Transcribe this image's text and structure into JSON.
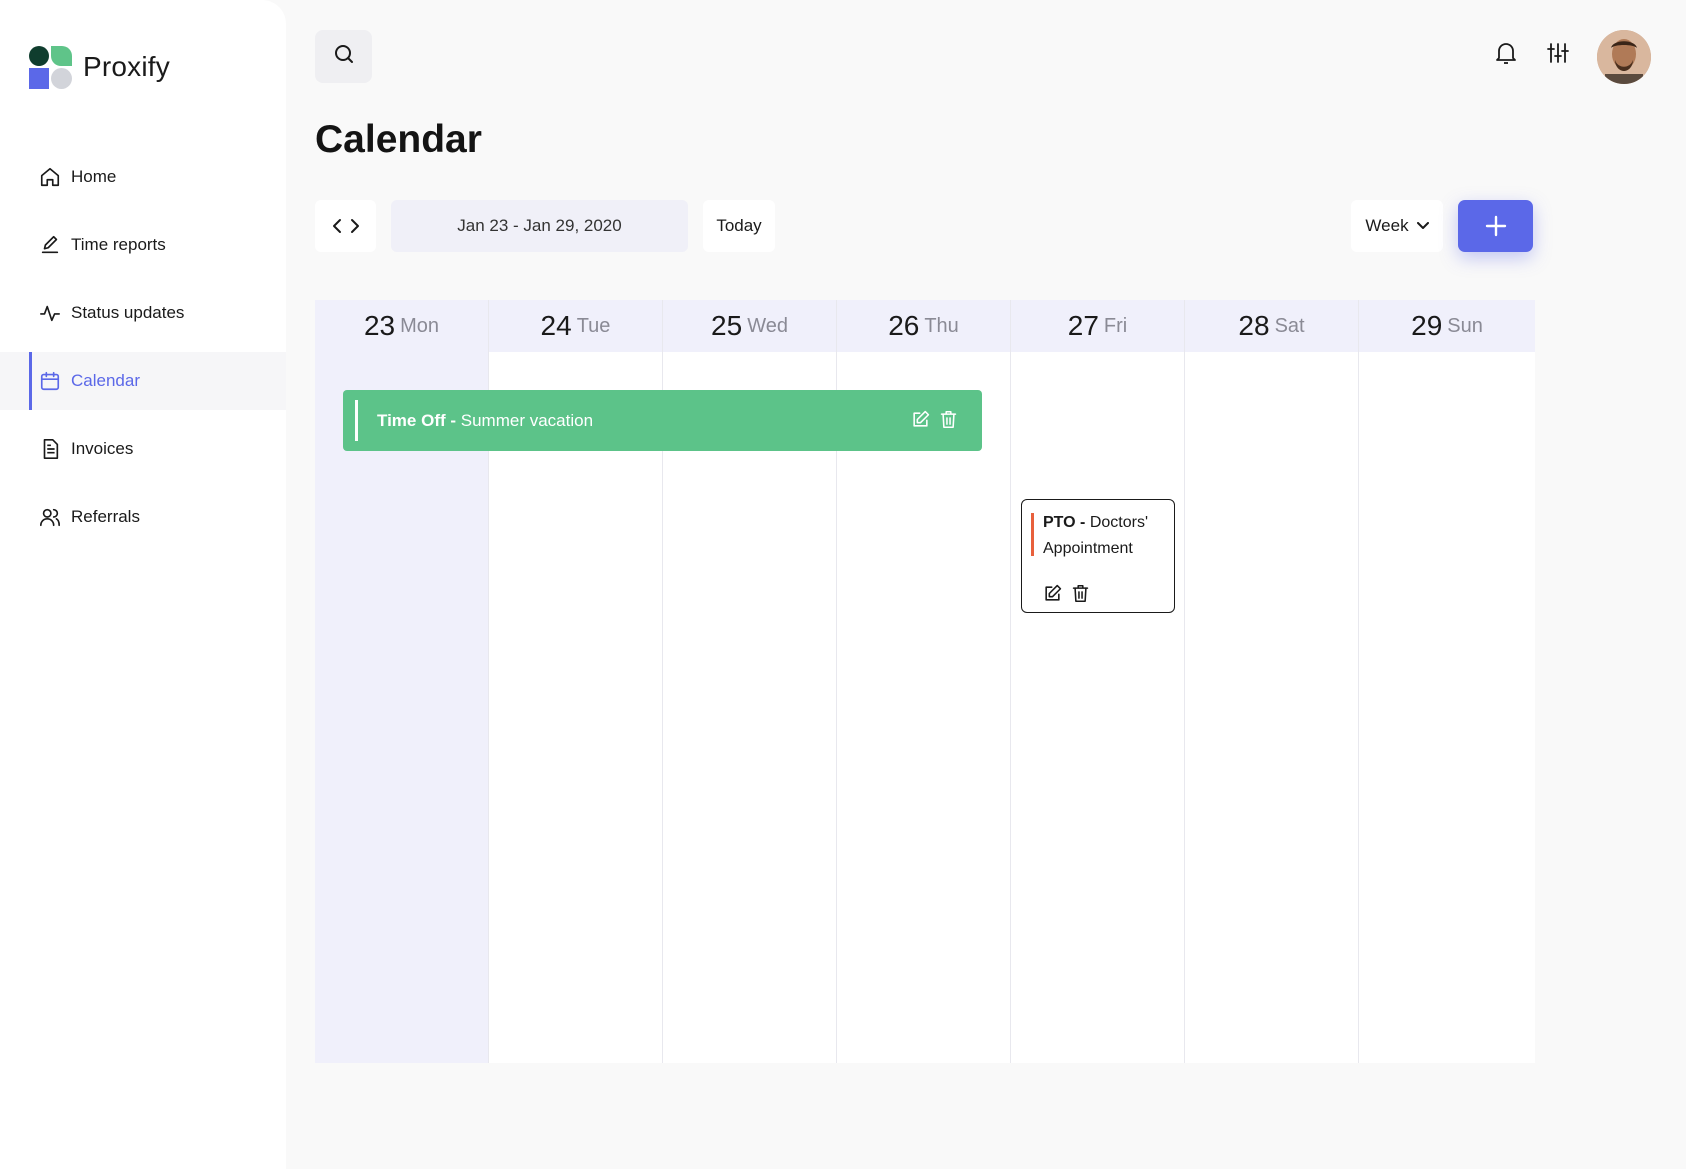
{
  "app": {
    "name": "Proxify"
  },
  "sidebar": {
    "items": [
      {
        "label": "Home",
        "icon": "home-icon",
        "active": false
      },
      {
        "label": "Time reports",
        "icon": "pencil-icon",
        "active": false
      },
      {
        "label": "Status updates",
        "icon": "activity-icon",
        "active": false
      },
      {
        "label": "Calendar",
        "icon": "calendar-icon",
        "active": true
      },
      {
        "label": "Invoices",
        "icon": "document-icon",
        "active": false
      },
      {
        "label": "Referrals",
        "icon": "users-icon",
        "active": false
      }
    ]
  },
  "page": {
    "title": "Calendar"
  },
  "toolbar": {
    "date_range": "Jan 23 - Jan 29, 2020",
    "today_label": "Today",
    "view_label": "Week"
  },
  "calendar": {
    "days": [
      {
        "num": "23",
        "name": "Mon",
        "today": true
      },
      {
        "num": "24",
        "name": "Tue"
      },
      {
        "num": "25",
        "name": "Wed"
      },
      {
        "num": "26",
        "name": "Thu"
      },
      {
        "num": "27",
        "name": "Fri"
      },
      {
        "num": "28",
        "name": "Sat"
      },
      {
        "num": "29",
        "name": "Sun"
      }
    ],
    "events": [
      {
        "type": "Time Off - ",
        "title": "Summer vacation",
        "color": "#5cc389"
      },
      {
        "type": "PTO - ",
        "title": "Doctors' Appointment",
        "color": "#e8603c"
      }
    ]
  },
  "colors": {
    "accent": "#5b68e8",
    "green_event": "#5cc389",
    "pto_marker": "#e8603c"
  }
}
